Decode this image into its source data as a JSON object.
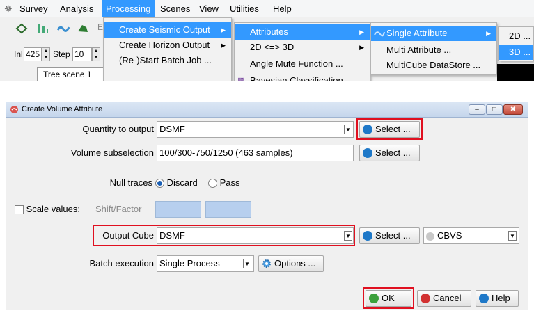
{
  "menubar": {
    "items": [
      "Survey",
      "Analysis",
      "Processing",
      "Scenes",
      "View",
      "Utilities",
      "Help"
    ]
  },
  "toolbar": {
    "inl_label": "Inl",
    "inl_value": "425",
    "step_label": "Step",
    "step_value": "10",
    "tree_label": "Tree scene 1"
  },
  "processing_menu": {
    "items": [
      "Create Seismic Output",
      "Create Horizon Output",
      "(Re-)Start Batch Job ..."
    ]
  },
  "seismic_submenu": {
    "items": [
      "Attributes",
      "2D <=> 3D",
      "Angle Mute Function ...",
      "Bayesian Classification"
    ]
  },
  "attributes_submenu": {
    "items": [
      "Single Attribute",
      "Multi Attribute ...",
      "MultiCube DataStore ..."
    ]
  },
  "dim_submenu": {
    "items": [
      "2D ...",
      "3D ..."
    ]
  },
  "dialog": {
    "title": "Create Volume Attribute",
    "quantity_label": "Quantity to output",
    "quantity_value": "DSMF",
    "select_label": "Select ...",
    "volume_label": "Volume subselection",
    "volume_value": "100/300-750/1250 (463 samples)",
    "null_traces_label": "Null traces",
    "discard_label": "Discard",
    "pass_label": "Pass",
    "scale_label": "Scale values:",
    "shift_factor_label": "Shift/Factor",
    "output_cube_label": "Output Cube",
    "output_cube_value": "DSMF",
    "format_value": "CBVS",
    "batch_label": "Batch execution",
    "batch_value": "Single Process",
    "options_label": "Options ...",
    "ok_label": "OK",
    "cancel_label": "Cancel",
    "help_label": "Help"
  },
  "colors": {
    "highlight": "#3399ff",
    "annotation_red": "#e01020",
    "select_icon_blue": "#1e78c8",
    "ok_green": "#3ca03c",
    "cancel_red": "#d23232"
  }
}
